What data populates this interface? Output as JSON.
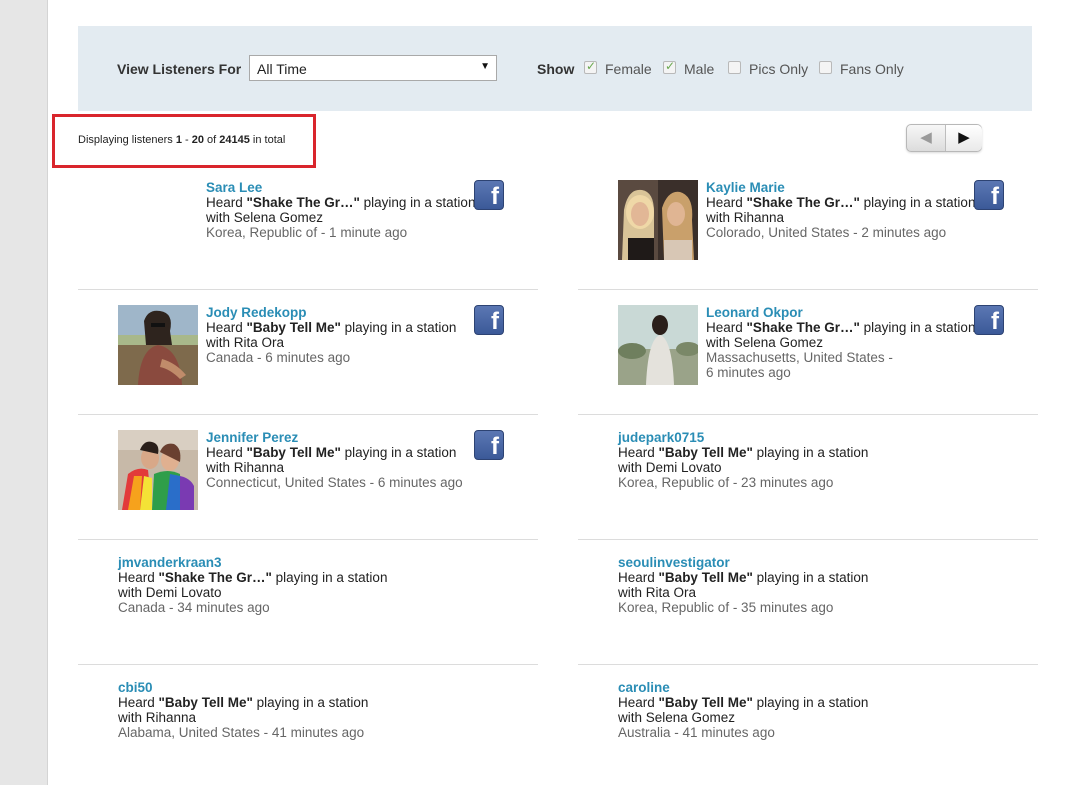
{
  "filter": {
    "view_label": "View Listeners For",
    "period_value": "All Time",
    "show_label": "Show",
    "options": [
      {
        "label": "Female",
        "checked": true
      },
      {
        "label": "Male",
        "checked": true
      },
      {
        "label": "Pics Only",
        "checked": false
      },
      {
        "label": "Fans Only",
        "checked": false
      }
    ]
  },
  "summary": {
    "prefix": "Displaying listeners ",
    "range_start": "1",
    "dash": " - ",
    "range_end": "20",
    "of": " of ",
    "total": "24145",
    "suffix": " in total"
  },
  "pager": {
    "prev_icon": "◀",
    "next_icon": "▶"
  },
  "listeners": [
    {
      "name": "Sara Lee",
      "heard": "Heard ",
      "song": "\"Shake The Gr…\"",
      "tail": " playing in a station",
      "artist": "with Selena Gomez",
      "location": "Korea, Republic of - 1 minute ago",
      "facebook": true
    },
    {
      "name": "Kaylie Marie",
      "heard": "Heard ",
      "song": "\"Shake The Gr…\"",
      "tail": " playing in a station",
      "artist": "with Rihanna",
      "location": "Colorado, United States - 2 minutes ago",
      "facebook": true
    },
    {
      "name": "Jody Redekopp",
      "heard": "Heard ",
      "song": "\"Baby Tell Me\"",
      "tail": " playing in a station",
      "artist": "with Rita Ora",
      "location": "Canada - 6 minutes ago",
      "facebook": true
    },
    {
      "name": "Leonard Okpor",
      "heard": "Heard ",
      "song": "\"Shake The Gr…\"",
      "tail": " playing in a station",
      "artist": "with Selena Gomez",
      "location": "Massachusetts, United States -",
      "location2": "6 minutes ago",
      "facebook": true
    },
    {
      "name": "Jennifer Perez",
      "heard": "Heard ",
      "song": "\"Baby Tell Me\"",
      "tail": " playing in a station",
      "artist": "with Rihanna",
      "location": "Connecticut, United States - 6 minutes ago",
      "facebook": true
    },
    {
      "name": "judepark0715",
      "heard": "Heard ",
      "song": "\"Baby Tell Me\"",
      "tail": " playing in a station",
      "artist": "with Demi Lovato",
      "location": "Korea, Republic of - 23 minutes ago",
      "facebook": false
    },
    {
      "name": "jmvanderkraan3",
      "heard": "Heard ",
      "song": "\"Shake The Gr…\"",
      "tail": " playing in a station",
      "artist": "with Demi Lovato",
      "location": "Canada - 34 minutes ago",
      "facebook": false
    },
    {
      "name": "seoulinvestigator",
      "heard": "Heard ",
      "song": "\"Baby Tell Me\"",
      "tail": " playing in a station",
      "artist": "with Rita Ora",
      "location": "Korea, Republic of - 35 minutes ago",
      "facebook": false
    },
    {
      "name": "cbi50",
      "heard": "Heard ",
      "song": "\"Baby Tell Me\"",
      "tail": " playing in a station",
      "artist": "with Rihanna",
      "location": "Alabama, United States - 41 minutes ago",
      "facebook": false
    },
    {
      "name": "caroline",
      "heard": "Heard ",
      "song": "\"Baby Tell Me\"",
      "tail": " playing in a station",
      "artist": "with Selena Gomez",
      "location": "Australia - 41 minutes ago",
      "facebook": false
    }
  ],
  "facebook_glyph": "f",
  "colors": {
    "accent": "#2a8db5",
    "highlight_border": "#d9252c",
    "filter_bg": "#e3ebf1",
    "facebook": "#3b5998"
  }
}
